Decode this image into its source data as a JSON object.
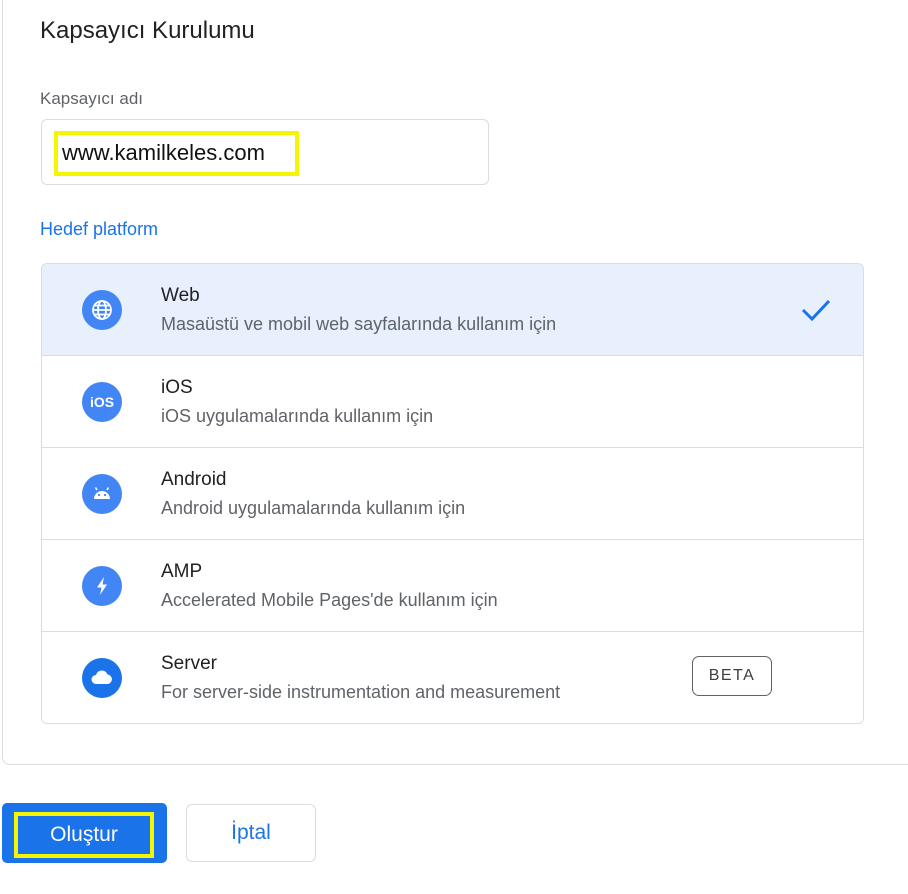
{
  "header": {
    "title": "Kapsayıcı Kurulumu"
  },
  "container_name": {
    "label": "Kapsayıcı adı",
    "value": "www.kamilkeles.com"
  },
  "target_platform": {
    "label": "Hedef platform",
    "items": [
      {
        "name": "Web",
        "description": "Masaüstü ve mobil web sayfalarında kullanım için",
        "icon": "globe-icon",
        "selected": true
      },
      {
        "name": "iOS",
        "description": "iOS uygulamalarında kullanım için",
        "icon": "ios-icon",
        "selected": false
      },
      {
        "name": "Android",
        "description": "Android uygulamalarında kullanım için",
        "icon": "android-icon",
        "selected": false
      },
      {
        "name": "AMP",
        "description": "Accelerated Mobile Pages'de kullanım için",
        "icon": "lightning-icon",
        "selected": false
      },
      {
        "name": "Server",
        "description": "For server-side instrumentation and measurement",
        "icon": "cloud-icon",
        "selected": false,
        "badge": "BETA"
      }
    ]
  },
  "actions": {
    "create_label": "Oluştur",
    "cancel_label": "İptal"
  },
  "colors": {
    "accent": "#1a73e8",
    "selected_bg": "#e8f0fe",
    "icon_bg": "#4285f4",
    "highlight": "#f5f500"
  }
}
